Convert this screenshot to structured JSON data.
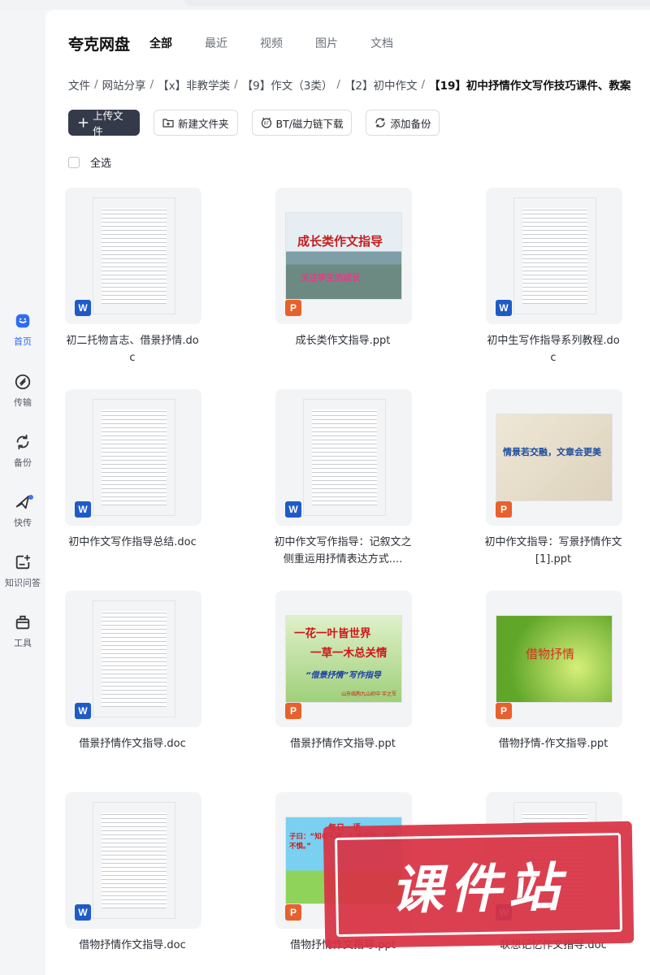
{
  "sidebar": {
    "items": [
      {
        "label": "首页",
        "icon": "home-icon",
        "active": true
      },
      {
        "label": "传输",
        "icon": "transfer-icon"
      },
      {
        "label": "备份",
        "icon": "backup-icon"
      },
      {
        "label": "快传",
        "icon": "quick-send-icon"
      },
      {
        "label": "知识问答",
        "icon": "knowledge-qa-icon"
      },
      {
        "label": "工具",
        "icon": "tools-icon"
      }
    ]
  },
  "header": {
    "brand": "夸克网盘",
    "tabs": [
      "全部",
      "最近",
      "视频",
      "图片",
      "文档"
    ]
  },
  "breadcrumb": [
    "文件",
    "网站分享",
    "【x】非教学类",
    "【9】作文（3类）",
    "【2】初中作文",
    "【19】初中抒情作文写作技巧课件、教案"
  ],
  "toolbar": {
    "upload": "上传文件",
    "new_folder": "新建文件夹",
    "bt": "BT/磁力链下载",
    "backup": "添加备份"
  },
  "select_all": "全选",
  "files": [
    {
      "name": "初二托物言志、借景抒情.doc",
      "type": "W"
    },
    {
      "name": "成长类作文指导.ppt",
      "type": "P",
      "slide": {
        "title": "成长类作文指导",
        "subtitle": "关注学生的成长"
      }
    },
    {
      "name": "初中生写作指导系列教程.doc",
      "type": "W"
    },
    {
      "name": "初中作文写作指导总结.doc",
      "type": "W"
    },
    {
      "name": "初中作文写作指导：记叙文之侧重运用抒情表达方式....",
      "type": "W"
    },
    {
      "name": "初中作文指导：写景抒情作文[1].ppt",
      "type": "P",
      "slide": {
        "title": "情景若交融，文章会更美"
      }
    },
    {
      "name": "借景抒情作文指导.doc",
      "type": "W"
    },
    {
      "name": "借景抒情作文指导.ppt",
      "type": "P",
      "slide": {
        "line1": "一花一叶皆世界",
        "line2": "一草一木总关情",
        "line3": "“借景抒情”写作指导",
        "footer": "山东临朐九山初中    宇之军"
      }
    },
    {
      "name": "借物抒情-作文指导.ppt",
      "type": "P",
      "slide": {
        "title": "借物抒情"
      }
    },
    {
      "name": "借物抒情作文指导.doc",
      "type": "W"
    },
    {
      "name": "借物抒情作文指导.ppt",
      "type": "P",
      "slide": {
        "title": "每日一语",
        "body": "子曰：“知者不惑，仁者不忧，勇者不惧。”"
      }
    },
    {
      "name": "联想记忆作文指导.doc",
      "type": "W"
    }
  ],
  "watermark": "课件站",
  "colors": {
    "primary_button": "#353a4a",
    "accent": "#2d6bf2",
    "word": "#1f5bc6",
    "ppt": "#e8612c",
    "watermark": "#d93244"
  }
}
